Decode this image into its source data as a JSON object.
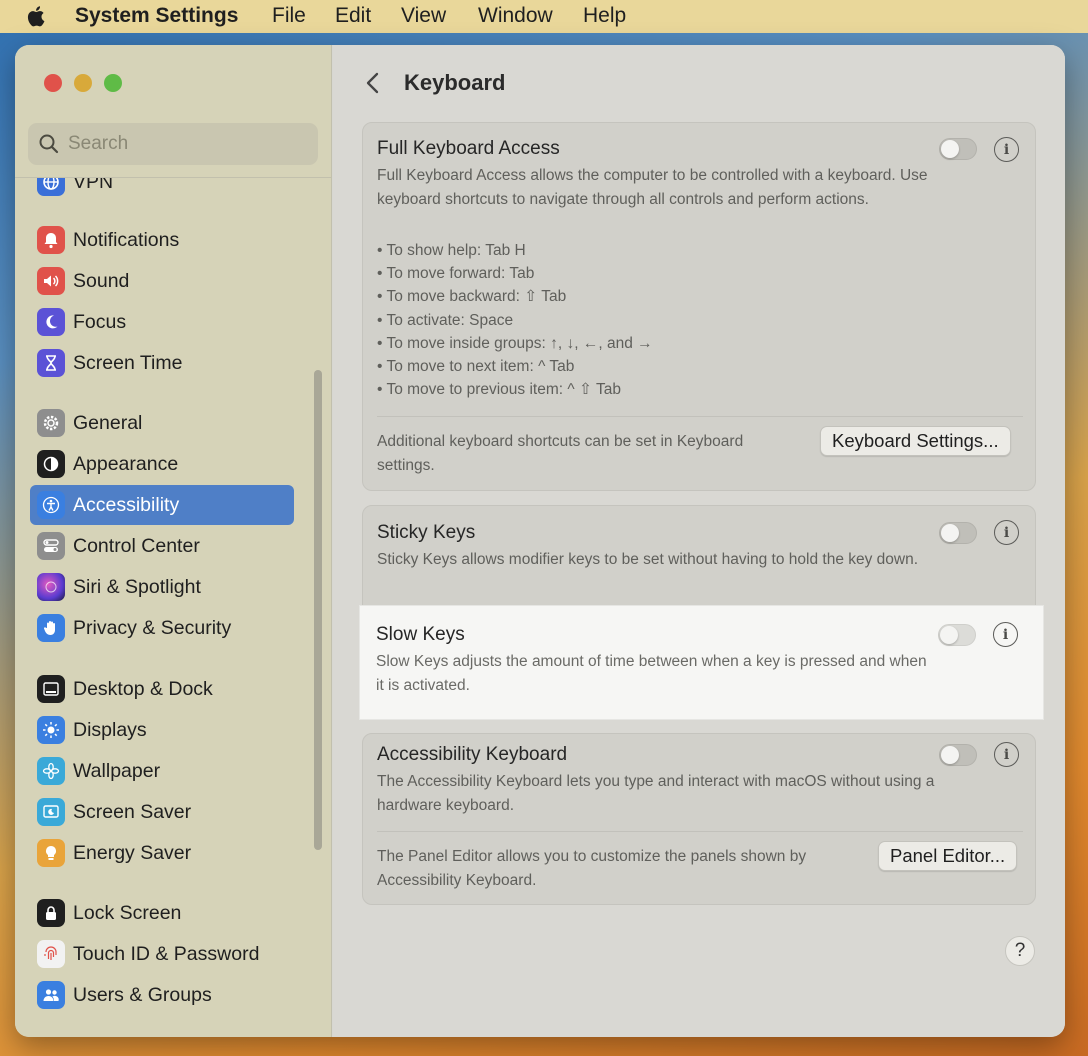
{
  "menubar": {
    "app_name": "System Settings",
    "menus": [
      "File",
      "Edit",
      "View",
      "Window",
      "Help"
    ]
  },
  "sidebar": {
    "search_placeholder": "Search",
    "items": [
      {
        "label": "VPN",
        "icon": "globe-icon",
        "color": "#3a6fd8"
      },
      {
        "label": "Notifications",
        "icon": "bell-icon",
        "color": "#e0524a"
      },
      {
        "label": "Sound",
        "icon": "speaker-icon",
        "color": "#e0524a"
      },
      {
        "label": "Focus",
        "icon": "moon-icon",
        "color": "#5b52d6"
      },
      {
        "label": "Screen Time",
        "icon": "hourglass-icon",
        "color": "#5b52d6"
      },
      {
        "label": "General",
        "icon": "gear-icon",
        "color": "#8e8e8e"
      },
      {
        "label": "Appearance",
        "icon": "appearance-icon",
        "color": "#1f1f1f"
      },
      {
        "label": "Accessibility",
        "icon": "accessibility-icon",
        "color": "#3a7fe0"
      },
      {
        "label": "Control Center",
        "icon": "toggles-icon",
        "color": "#8e8e8e"
      },
      {
        "label": "Siri & Spotlight",
        "icon": "siri-icon",
        "color": "#b04ad0"
      },
      {
        "label": "Privacy & Security",
        "icon": "hand-icon",
        "color": "#3a7fe0"
      },
      {
        "label": "Desktop & Dock",
        "icon": "dock-icon",
        "color": "#1f1f1f"
      },
      {
        "label": "Displays",
        "icon": "sun-icon",
        "color": "#3a7fe0"
      },
      {
        "label": "Wallpaper",
        "icon": "flower-icon",
        "color": "#3aa9d8"
      },
      {
        "label": "Screen Saver",
        "icon": "screensaver-icon",
        "color": "#3aa9d8"
      },
      {
        "label": "Energy Saver",
        "icon": "bulb-icon",
        "color": "#e9a43a"
      },
      {
        "label": "Lock Screen",
        "icon": "lock-icon",
        "color": "#1f1f1f"
      },
      {
        "label": "Touch ID & Password",
        "icon": "fingerprint-icon",
        "color": "#e0524a"
      },
      {
        "label": "Users & Groups",
        "icon": "users-icon",
        "color": "#3a7fe0"
      }
    ],
    "active_index": 7
  },
  "main": {
    "title": "Keyboard",
    "full_keyboard_access": {
      "title": "Full Keyboard Access",
      "description": "Full Keyboard Access allows the computer to be controlled with a keyboard. Use keyboard shortcuts to navigate through all controls and perform actions.",
      "bullets": [
        "• To show help: Tab H",
        "• To move forward: Tab",
        "• To move backward: ⇧ Tab",
        "• To activate: Space",
        "• To move inside groups: ↑, ↓, ←, and →",
        "• To move to next item: ^ Tab",
        "• To move to previous item: ^ ⇧ Tab"
      ],
      "footer": "Additional keyboard shortcuts can be set in Keyboard settings.",
      "button": "Keyboard Settings...",
      "enabled": false
    },
    "sticky_keys": {
      "title": "Sticky Keys",
      "description": "Sticky Keys allows modifier keys to be set without having to hold the key down.",
      "enabled": false
    },
    "slow_keys": {
      "title": "Slow Keys",
      "description": "Slow Keys adjusts the amount of time between when a key is pressed and when it is activated.",
      "enabled": false
    },
    "accessibility_keyboard": {
      "title": "Accessibility Keyboard",
      "description": "The Accessibility Keyboard lets you type and interact with macOS without using a hardware keyboard.",
      "footer": "The Panel Editor allows you to customize the panels shown by Accessibility Keyboard.",
      "button": "Panel Editor...",
      "enabled": false
    },
    "help": "?",
    "info": "i"
  }
}
